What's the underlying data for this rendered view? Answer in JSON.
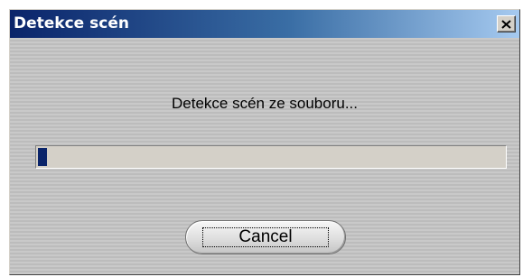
{
  "window": {
    "title": "Detekce scén",
    "close_icon": "close-x-icon"
  },
  "content": {
    "message": "Detekce scén ze souboru...",
    "progress": {
      "fraction": 0.02,
      "fill_color": "#0a246a"
    },
    "cancel_label": "Cancel"
  },
  "colors": {
    "titlebar_start": "#0a246a",
    "titlebar_end": "#a6caf0",
    "client_background": "#c6c6c6"
  }
}
